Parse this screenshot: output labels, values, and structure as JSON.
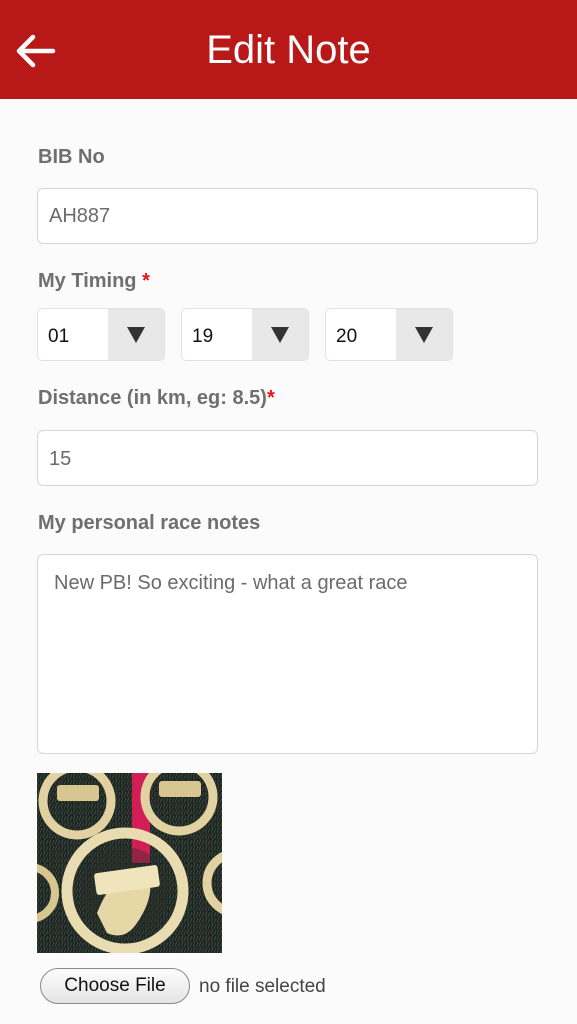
{
  "header": {
    "title": "Edit Note",
    "back_icon": "arrow-left-icon",
    "color": "#b81818"
  },
  "form": {
    "bib": {
      "label": "BIB No",
      "value": "AH887"
    },
    "timing": {
      "label": "My Timing",
      "required_mark": "*",
      "hours": "01",
      "minutes": "19",
      "seconds": "20"
    },
    "distance": {
      "label": "Distance (in km, eg: 8.5)",
      "required_mark": "*",
      "value": "15"
    },
    "notes": {
      "label": "My personal race notes",
      "value": "New PB! So exciting - what a great race"
    },
    "photo": {
      "subject": "race medals"
    },
    "file": {
      "button_label": "Choose File",
      "status": "no file selected"
    }
  }
}
